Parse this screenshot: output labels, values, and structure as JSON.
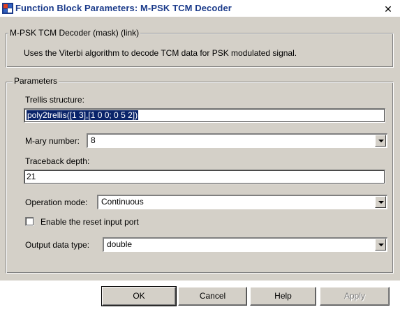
{
  "window": {
    "title": "Function Block Parameters: M-PSK TCM Decoder",
    "close_symbol": "✕"
  },
  "mask": {
    "legend": "M-PSK TCM Decoder (mask) (link)",
    "description": "Uses the Viterbi algorithm to decode TCM data for PSK modulated signal."
  },
  "parameters": {
    "legend": "Parameters",
    "trellis_label": "Trellis structure:",
    "trellis_value": "poly2trellis([1 3],[1 0 0; 0 5 2])",
    "mary_label": "M-ary number:",
    "mary_value": "8",
    "traceback_label": "Traceback depth:",
    "traceback_value": "21",
    "opmode_label": "Operation mode:",
    "opmode_value": "Continuous",
    "reset_label": "Enable the reset input port",
    "reset_checked": false,
    "outtype_label": "Output data type:",
    "outtype_value": "double"
  },
  "buttons": {
    "ok": "OK",
    "cancel": "Cancel",
    "help": "Help",
    "apply": "Apply"
  },
  "icons": {
    "app": "simulink-block-icon",
    "close": "close-icon",
    "dropdown": "chevron-down-icon"
  },
  "colors": {
    "selection": "#0a246a",
    "title_text": "#1a3a8a",
    "dialog_bg": "#d4d0c8"
  }
}
